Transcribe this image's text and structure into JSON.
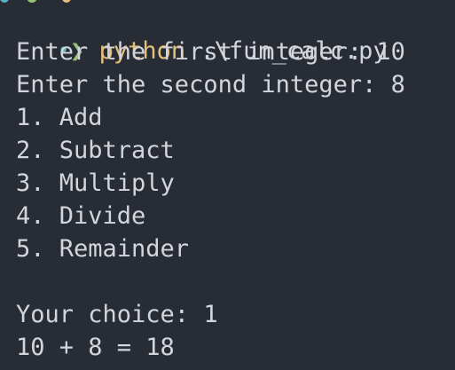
{
  "terminal": {
    "prompt_symbol": "❯",
    "command": "python",
    "args": ".\\fun_calc.py",
    "lines": [
      "Enter the first integer: 10",
      "Enter the second integer: 8",
      "1. Add",
      "2. Subtract",
      "3. Multiply",
      "4. Divide",
      "5. Remainder",
      "",
      "Your choice: 1",
      "10 + 8 = 18"
    ]
  },
  "colors": {
    "background": "#282c34",
    "text": "#d2d6dc",
    "prompt_arrow": "#98c379",
    "command": "#e5c07b",
    "status_dot": "#56b6c2"
  }
}
